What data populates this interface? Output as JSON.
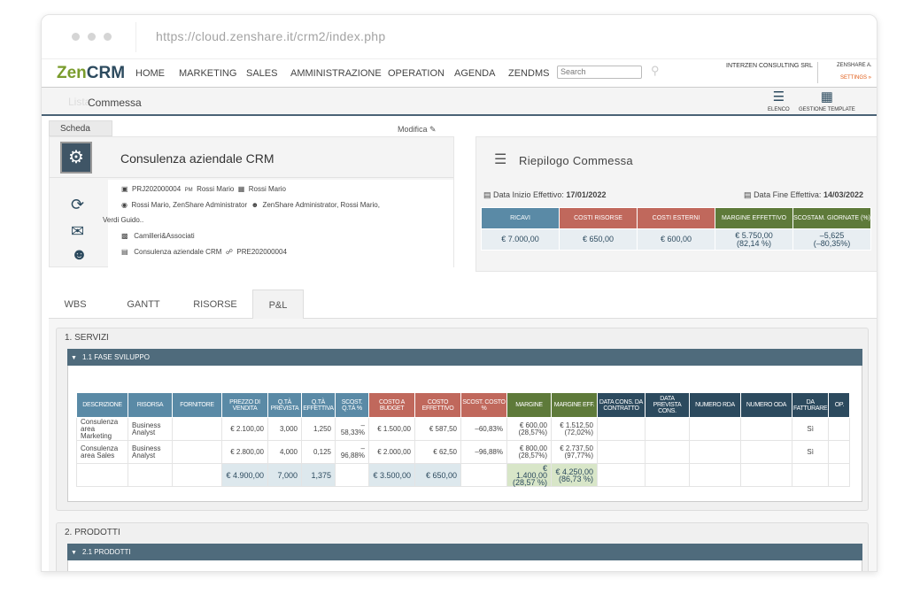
{
  "browser": {
    "url": "https://cloud.zenshare.it/crm2/index.php"
  },
  "logo": {
    "part1": "Zen",
    "part2": "CRM"
  },
  "nav": {
    "items": [
      "HOME",
      "MARKETING",
      "SALES",
      "AMMINISTRAZIONE",
      "OPERATION",
      "AGENDA",
      "ZENDMS"
    ],
    "search_placeholder": "Search",
    "company": "INTERZEN CONSULTING SRL",
    "user": "ZENSHARE A.",
    "settings": "SETTINGS »"
  },
  "breadcrumb": {
    "title": "Commessa",
    "ghost": "Lista"
  },
  "toolbar": {
    "elenco": "ELENCO",
    "template": "GESTIONE TEMPLATE"
  },
  "scheda": {
    "tab": "Scheda",
    "modifica": "Modifica"
  },
  "project": {
    "title": "Consulenza aziendale CRM",
    "code": "PRJ202000004",
    "pm_label": "PM",
    "pm": "Rossi Mario",
    "owner": "Rossi Mario",
    "viewers": "Rossi Mario, ZenShare Administrator",
    "team": "ZenShare Administrator, Rossi Mario,",
    "team_more": "Verdi Guido..",
    "client": "Camilleri&Associati",
    "opportunity": "Consulenza aziendale CRM",
    "pre_code": "PRE202000004"
  },
  "riepilogo": {
    "title": "Riepilogo Commessa",
    "start_label": "Data Inizio Effettivo:",
    "start": "17/01/2022",
    "end_label": "Data Fine Effettiva:",
    "end": "14/03/2022",
    "headers": [
      "RICAVI",
      "COSTI RISORSE",
      "COSTI ESTERNI",
      "MARGINE EFFETTIVO",
      "SCOSTAM. GIORNATE (%)"
    ],
    "values": [
      "€ 7.000,00",
      "€ 650,00",
      "€ 600,00",
      "€ 5.750,00",
      "–5,625"
    ],
    "values2": [
      "",
      "",
      "",
      "(82,14 %)",
      "(–80,35%)"
    ]
  },
  "colors": {
    "dark": "#2c4a5e",
    "blue": "#5a8aa6",
    "red": "#c0685c",
    "green": "#5e7a3a",
    "bar": "#4f6b7c"
  },
  "tabs": [
    "WBS",
    "GANTT",
    "RISORSE",
    "P&L"
  ],
  "servizi": {
    "title": "1. SERVIZI",
    "phase": "1.1 FASE SVILUPPO",
    "headers": [
      "DESCRIZIONE",
      "RISORSA",
      "FORNITORE",
      "PREZZO DI VENDITA",
      "Q.TÀ PREVISTA",
      "Q.TÀ EFFETTIVA",
      "SCOST. Q.TÀ %",
      "COSTO A BUDGET",
      "COSTO EFFETTIVO",
      "SCOST. COSTO %",
      "MARGINE",
      "MARGINE EFF.",
      "DATA CONS. DA CONTRATTO",
      "DATA PREVISTA CONS.",
      "NUMERO RDA",
      "NUMERO ODA",
      "DA FATTURARE",
      "OP."
    ],
    "rows": [
      [
        "Consulenza area Marketing",
        "Business Analyst",
        "",
        "€ 2.100,00",
        "3,000",
        "1,250",
        "–58,33%",
        "€ 1.500,00",
        "€ 587,50",
        "–60,83%",
        "€ 600,00 (28,57%)",
        "€ 1.512,50 (72,02%)",
        "",
        "",
        "",
        "",
        "Sì",
        ""
      ],
      [
        "Consulenza area Sales",
        "Business Analyst",
        "",
        "€ 2.800,00",
        "4,000",
        "0,125",
        "–96,88%",
        "€ 2.000,00",
        "€ 62,50",
        "–96,88%",
        "€ 800,00 (28,57%)",
        "€ 2.737,50 (97,77%)",
        "",
        "",
        "",
        "",
        "Sì",
        ""
      ]
    ],
    "totals": [
      "",
      "",
      "",
      "€ 4.900,00",
      "7,000",
      "1,375",
      "",
      "€ 3.500,00",
      "€ 650,00",
      "",
      "€ 1.400,00 (28,57 %)",
      "€ 4.250,00 (86,73 %)",
      "",
      "",
      "",
      "",
      "",
      ""
    ]
  },
  "prodotti": {
    "title": "2. PRODOTTI",
    "phase": "2.1 PRODOTTI"
  }
}
